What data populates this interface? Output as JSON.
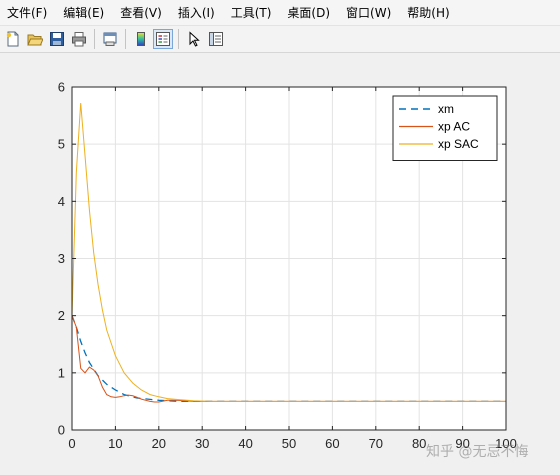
{
  "menubar": {
    "items": [
      "文件(F)",
      "编辑(E)",
      "查看(V)",
      "插入(I)",
      "工具(T)",
      "桌面(D)",
      "窗口(W)",
      "帮助(H)"
    ]
  },
  "toolbar": {
    "buttons": [
      {
        "name": "new-figure-icon"
      },
      {
        "name": "open-file-icon"
      },
      {
        "name": "save-icon"
      },
      {
        "name": "print-icon"
      },
      {
        "name": "link-plot-icon"
      },
      {
        "name": "insert-colorbar-icon"
      },
      {
        "name": "insert-legend-icon",
        "active": true
      },
      {
        "name": "edit-plot-arrow-icon"
      },
      {
        "name": "property-inspector-icon"
      }
    ]
  },
  "watermark": "知乎 @无忌不悔",
  "chart_data": {
    "type": "line",
    "xlim": [
      0,
      100
    ],
    "ylim": [
      0,
      6
    ],
    "x_ticks": [
      0,
      10,
      20,
      30,
      40,
      50,
      60,
      70,
      80,
      90,
      100
    ],
    "y_ticks": [
      0,
      1,
      2,
      3,
      4,
      5,
      6
    ],
    "grid": true,
    "legend_position": "top-right",
    "series": [
      {
        "name": "xm",
        "color": "#0072bd",
        "style": "dashed",
        "x": [
          0,
          1,
          2,
          3,
          4,
          6,
          8,
          10,
          12,
          15,
          20,
          25,
          30,
          35,
          40,
          100
        ],
        "y": [
          2.0,
          1.8,
          1.55,
          1.35,
          1.18,
          0.95,
          0.8,
          0.7,
          0.62,
          0.56,
          0.52,
          0.5,
          0.5,
          0.5,
          0.5,
          0.5
        ]
      },
      {
        "name": "xp AC",
        "color": "#d95319",
        "style": "solid",
        "x": [
          0,
          1,
          2,
          3,
          4,
          5,
          6,
          7,
          8,
          9,
          10,
          11,
          12,
          13,
          14,
          15,
          16,
          17,
          18,
          19,
          20,
          22,
          24,
          26,
          28,
          30,
          35,
          40,
          100
        ],
        "y": [
          2.0,
          1.8,
          1.08,
          1.0,
          1.1,
          1.05,
          0.95,
          0.75,
          0.62,
          0.58,
          0.57,
          0.58,
          0.6,
          0.61,
          0.6,
          0.57,
          0.54,
          0.52,
          0.5,
          0.49,
          0.49,
          0.52,
          0.52,
          0.51,
          0.5,
          0.5,
          0.5,
          0.5,
          0.5
        ]
      },
      {
        "name": "xp SAC",
        "color": "#edb120",
        "style": "solid",
        "x": [
          0,
          1,
          2,
          3,
          4,
          5,
          6,
          7,
          8,
          10,
          12,
          14,
          16,
          18,
          20,
          22,
          25,
          28,
          32,
          35,
          40,
          100
        ],
        "y": [
          2.0,
          4.5,
          5.72,
          4.8,
          3.85,
          3.1,
          2.55,
          2.1,
          1.75,
          1.3,
          1.0,
          0.82,
          0.7,
          0.62,
          0.58,
          0.55,
          0.53,
          0.51,
          0.5,
          0.5,
          0.5,
          0.5
        ]
      }
    ]
  }
}
